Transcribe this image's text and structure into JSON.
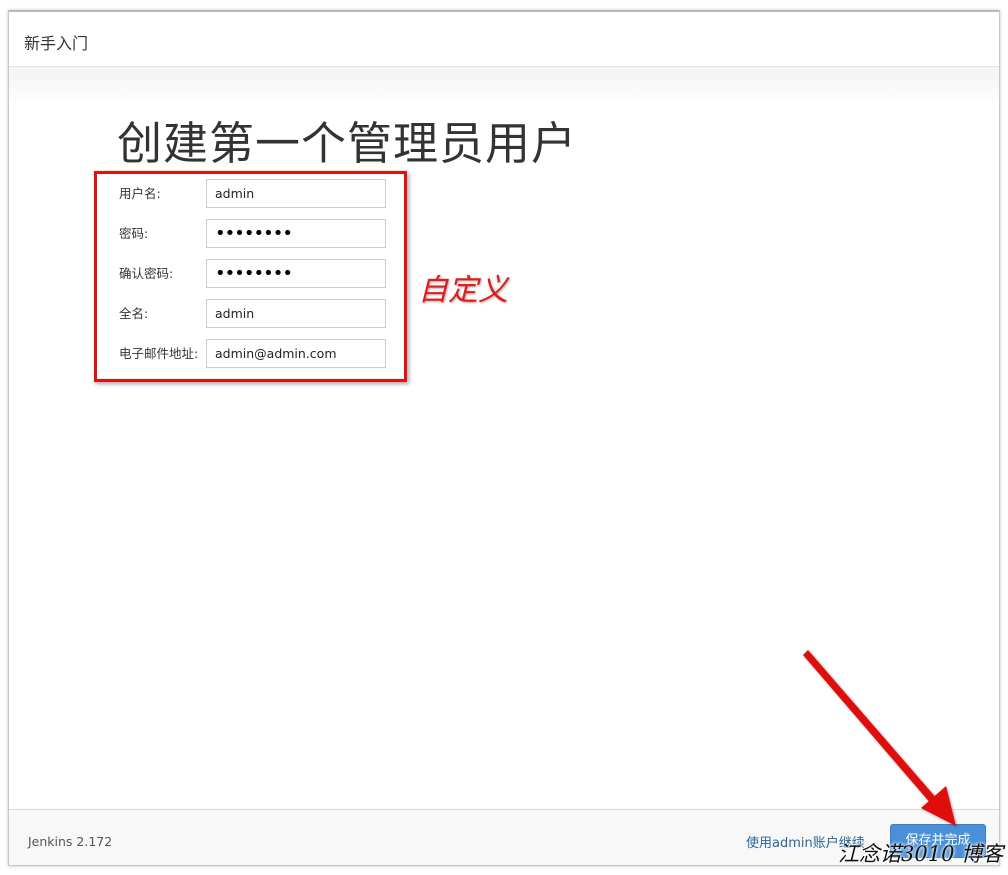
{
  "window": {
    "title": "新手入门"
  },
  "main": {
    "heading": "创建第一个管理员用户"
  },
  "form": {
    "username": {
      "label": "用户名:",
      "value": "admin"
    },
    "password": {
      "label": "密码:",
      "value": "••••••••"
    },
    "confirm_password": {
      "label": "确认密码:",
      "value": "••••••••"
    },
    "full_name": {
      "label": "全名:",
      "value": "admin"
    },
    "email": {
      "label": "电子邮件地址:",
      "value": "admin@admin.com"
    }
  },
  "annotation": {
    "text": "自定义",
    "color": "#e21c1c"
  },
  "footer": {
    "version": "Jenkins 2.172",
    "skip_link": "使用admin账户继续",
    "save_button": "保存并完成"
  },
  "watermark": "江念诺3010 博客",
  "colors": {
    "accent": "#4a90d9",
    "link": "#2a6496",
    "annotation_red": "#e01010"
  }
}
